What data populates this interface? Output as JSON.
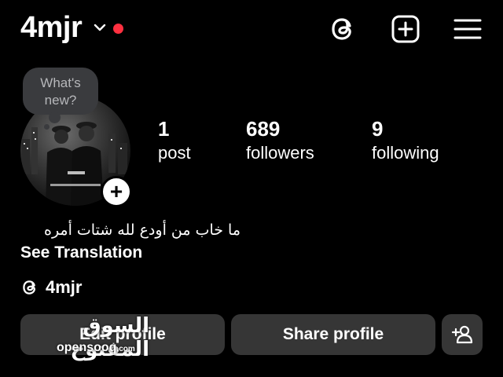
{
  "header": {
    "username": "4mjr",
    "notification_dot_color": "#ff3040",
    "icons": [
      "threads-icon",
      "create-post-icon",
      "menu-icon"
    ]
  },
  "note": {
    "text": "What's new?"
  },
  "profile": {
    "stats": [
      {
        "value": "1",
        "label": "post"
      },
      {
        "value": "689",
        "label": "followers"
      },
      {
        "value": "9",
        "label": "following"
      }
    ],
    "bio": "ما خاب من أودع لله شتات أمره",
    "see_translation": "See Translation",
    "threads_handle": "4mjr"
  },
  "actions": {
    "edit_profile": "Edit profile",
    "share_profile": "Share profile"
  },
  "watermark": {
    "arabic": "السوق المفتوح",
    "latin": "opensooq",
    "suffix": ".com"
  }
}
